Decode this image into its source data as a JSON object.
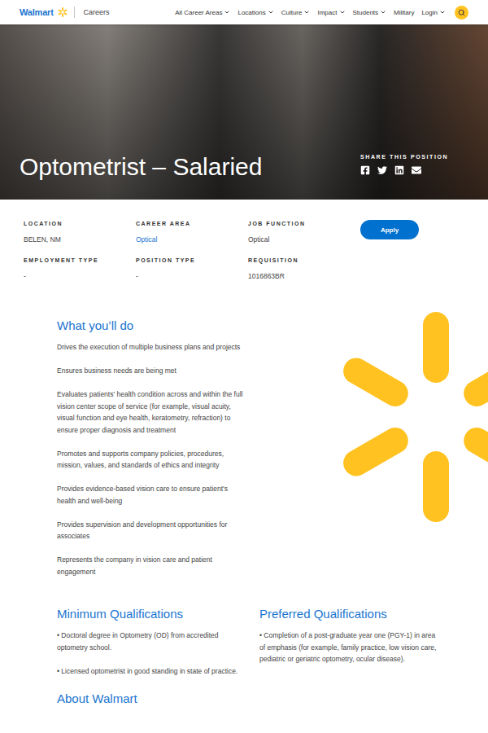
{
  "header": {
    "logo": "Walmart",
    "section": "Careers",
    "nav": [
      {
        "label": "All Career Areas",
        "dropdown": true
      },
      {
        "label": "Locations",
        "dropdown": true
      },
      {
        "label": "Culture",
        "dropdown": true
      },
      {
        "label": "Impact",
        "dropdown": true
      },
      {
        "label": "Students",
        "dropdown": true
      },
      {
        "label": "Military",
        "dropdown": false
      },
      {
        "label": "Login",
        "dropdown": true
      }
    ]
  },
  "hero": {
    "title": "Optometrist – Salaried",
    "share_label": "SHARE THIS POSITION"
  },
  "details": [
    {
      "label": "LOCATION",
      "value": "BELEN, NM",
      "link": false
    },
    {
      "label": "CAREER AREA",
      "value": "Optical",
      "link": true
    },
    {
      "label": "JOB FUNCTION",
      "value": "Optical",
      "link": false
    },
    {
      "label": "EMPLOYMENT TYPE",
      "value": "-",
      "link": false
    },
    {
      "label": "POSITION TYPE",
      "value": "-",
      "link": false
    },
    {
      "label": "REQUISITION",
      "value": "1016863BR",
      "link": false
    }
  ],
  "apply_button": "Apply",
  "duties": {
    "title": "What you’ll do",
    "items": [
      "Drives the execution of multiple business plans and projects",
      "Ensures business needs are being met",
      "Evaluates patients' health condition across and within the full vision center scope of service (for example, visual acuity, visual function and eye health, keratometry, refraction) to ensure proper diagnosis and treatment",
      "Promotes and supports company policies, procedures, mission, values, and standards of ethics and integrity",
      "Provides evidence-based vision care to ensure patient's health and well-being",
      "Provides supervision and development opportunities for associates",
      "Represents the company in vision care and patient engagement"
    ]
  },
  "qualifications": [
    {
      "title": "Minimum Qualifications",
      "items": [
        "• Doctoral degree in Optometry (OD) from accredited optometry school.",
        "• Licensed optometrist in good standing in state of practice."
      ]
    },
    {
      "title": "Preferred Qualifications",
      "items": [
        "• Completion of a post-graduate year one (PGY-1) in area of emphasis (for example, family practice, low vision care, pediatric or geriatric optometry, ocular disease)."
      ]
    }
  ],
  "about": {
    "title": "About Walmart"
  }
}
